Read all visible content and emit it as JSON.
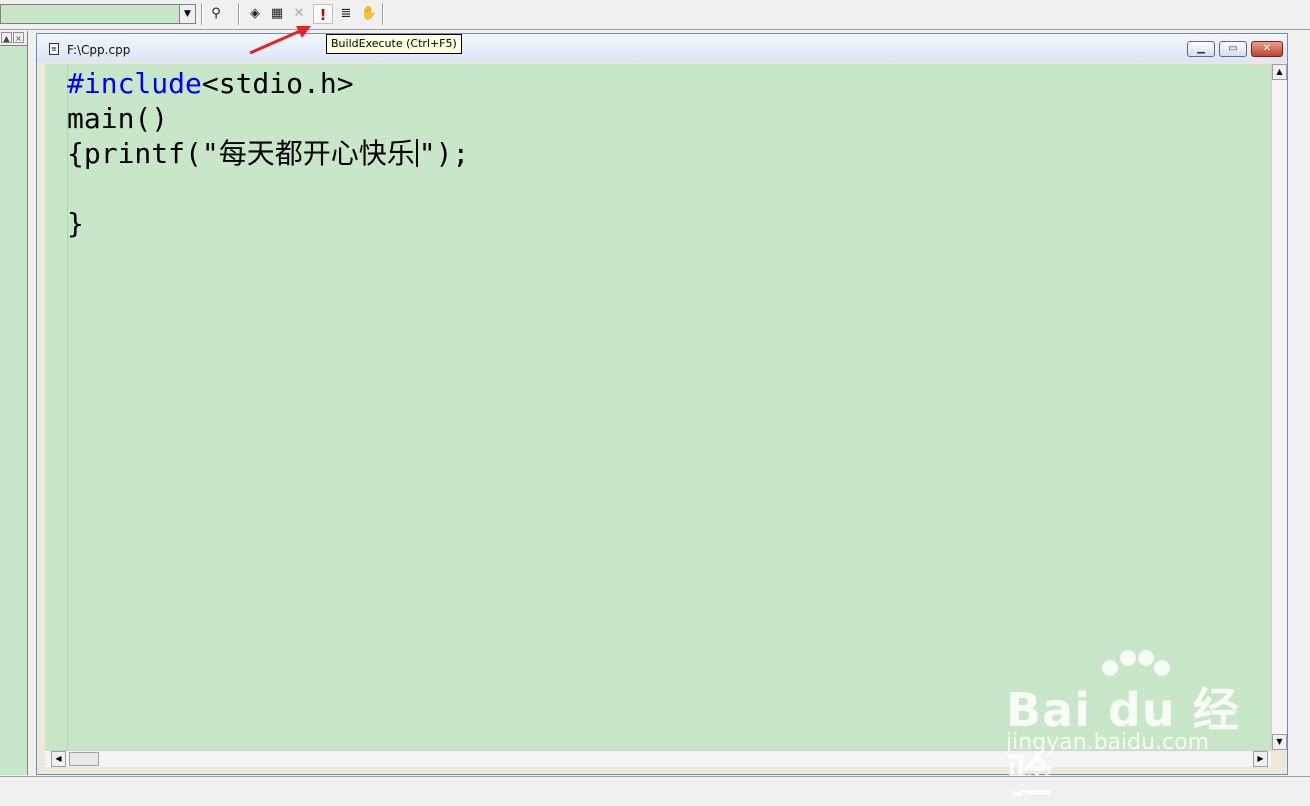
{
  "toolbar": {
    "icons": [
      "find-in-files-icon",
      "compile-icon",
      "build-icon",
      "stop-build-icon",
      "execute-icon",
      "breakpoint-list-icon",
      "hand-icon"
    ],
    "execute_glyph": "!",
    "tooltip": "BuildExecute (Ctrl+F5)"
  },
  "document": {
    "title": "F:\\Cpp.cpp",
    "window_buttons": [
      "minimize",
      "restore",
      "close"
    ]
  },
  "editor": {
    "lines": [
      {
        "kw": "#include",
        "text": "<stdio.h>"
      },
      {
        "kw": "",
        "text": "main()"
      },
      {
        "kw": "",
        "text": "{printf(\"每天都开心快乐",
        "after_caret": "\");"
      },
      {
        "kw": "",
        "text": ""
      },
      {
        "kw": "",
        "text": "}"
      }
    ],
    "background": "#c8e6c8",
    "keyword_color": "#0000ff"
  },
  "watermark": {
    "logo": "Bai du 经验",
    "url": "jingyan.baidu.com"
  },
  "annotation": {
    "arrow_color": "#e8202a"
  }
}
